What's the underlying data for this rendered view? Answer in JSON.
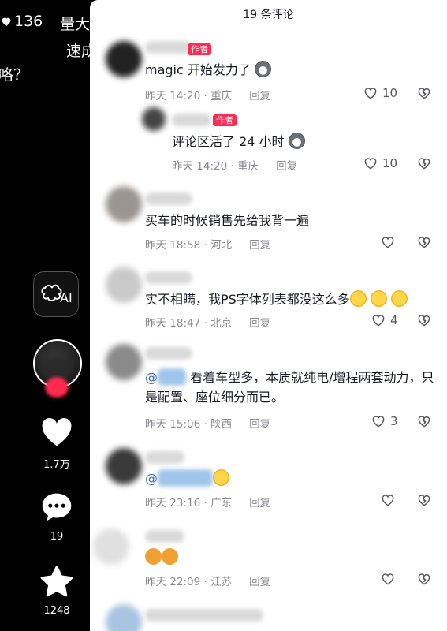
{
  "left": {
    "likes_count": "136",
    "caption_line1": "量大",
    "caption_line2": "速成",
    "caption_line3": "咯？",
    "ai_label": "AI",
    "like_count": "1.7万",
    "comment_count": "19",
    "favorite_count": "1248"
  },
  "panel": {
    "title": "19 条评论",
    "author_tag": "作者",
    "reply_label": "回复"
  },
  "comments": [
    {
      "text": "magic 开始发力了",
      "time_loc": "昨天 14:20 · 重庆",
      "likes": "10"
    },
    {
      "text": "评论区活了 24 小时",
      "time_loc": "昨天 14:20 · 重庆",
      "likes": "10"
    },
    {
      "text": "买车的时候销售先给我背一遍",
      "time_loc": "昨天 18:58 · 河北",
      "likes": ""
    },
    {
      "text": "实不相瞒，我PS字体列表都没这么多",
      "time_loc": "昨天 18:47 · 北京",
      "likes": "4"
    },
    {
      "text_a": "@",
      "text_b": "看着车型多，本质就纯电/增程两套动力，只是配置、座位细分而已。",
      "time_loc": "昨天 15:06 · 陕西",
      "likes": "3"
    },
    {
      "text_a": "@",
      "time_loc": "昨天 23:16 · 广东",
      "likes": ""
    },
    {
      "time_loc": "昨天 22:09 · 江苏",
      "likes": ""
    }
  ]
}
